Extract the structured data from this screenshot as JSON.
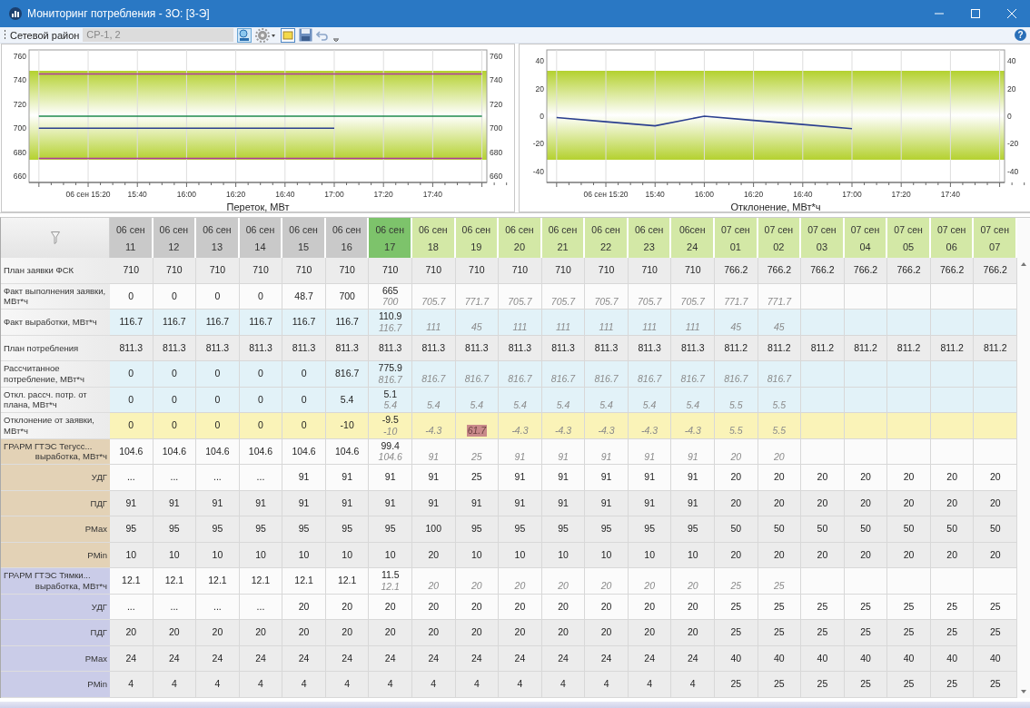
{
  "window": {
    "title": "Мониторинг потребления - 3О: [3-Э]"
  },
  "toolbar": {
    "label": "Сетевой район",
    "field_value": "СР-1, 2",
    "help": "?"
  },
  "charts": [
    {
      "left_axis_labels": [
        "760",
        "740",
        "720",
        "700",
        "680",
        "660"
      ],
      "chart_data": {
        "type": "line",
        "xlabel": "Переток, МВт",
        "categories": [
          null,
          "06 сен 15:20",
          "15:40",
          "16:00",
          "16:20",
          "16:40",
          "17:00",
          "17:20",
          "17:40",
          null
        ],
        "ylim": [
          655,
          765
        ],
        "yticks": [
          {
            "value": 660,
            "label": "660"
          },
          {
            "value": 680,
            "label": "680"
          },
          {
            "value": 700,
            "label": "700"
          },
          {
            "value": 720,
            "label": "720"
          },
          {
            "value": 740,
            "label": "740"
          },
          {
            "value": 760,
            "label": "760"
          }
        ],
        "grid": true,
        "series": [
          {
            "color": "#b03aa0",
            "values": [
              745,
              745,
              745,
              745,
              745,
              745,
              745,
              745,
              745,
              745
            ]
          },
          {
            "color": "#b03aa0",
            "values": [
              675,
              675,
              675,
              675,
              675,
              675,
              675,
              675,
              675,
              675
            ]
          },
          {
            "color": "#1f8a4c",
            "values": [
              710,
              710,
              710,
              710,
              710,
              710,
              710,
              710,
              710,
              710
            ]
          },
          {
            "color": "#2b3f8f",
            "values": [
              700,
              700,
              700,
              700,
              700,
              700,
              700,
              null,
              null,
              null
            ]
          }
        ]
      }
    },
    {
      "left_axis_labels": [
        "40",
        "20",
        "0",
        "-20",
        "-40"
      ],
      "chart_data": {
        "type": "line",
        "xlabel": "Отклонение, МВт*ч",
        "categories": [
          null,
          "06 сен 15:20",
          "15:40",
          "16:00",
          "16:20",
          "16:40",
          "17:00",
          "17:20",
          "17:40",
          null
        ],
        "ylim": [
          -48,
          48
        ],
        "yticks": [
          {
            "value": -40,
            "label": "-40"
          },
          {
            "value": -20,
            "label": "-20"
          },
          {
            "value": 0,
            "label": "0"
          },
          {
            "value": 20,
            "label": "20"
          },
          {
            "value": 40,
            "label": "40"
          }
        ],
        "grid": true,
        "series": [
          {
            "color": "#2b3f8f",
            "values": [
              -1,
              -4,
              -7,
              0,
              -3,
              -6,
              -9,
              null,
              null,
              null
            ]
          }
        ]
      }
    }
  ],
  "table": {
    "columns": [
      {
        "date": "06 сен",
        "hour": "11",
        "kind": "past"
      },
      {
        "date": "06 сен",
        "hour": "12",
        "kind": "past"
      },
      {
        "date": "06 сен",
        "hour": "13",
        "kind": "past"
      },
      {
        "date": "06 сен",
        "hour": "14",
        "kind": "past"
      },
      {
        "date": "06 сен",
        "hour": "15",
        "kind": "past"
      },
      {
        "date": "06 сен",
        "hour": "16",
        "kind": "past"
      },
      {
        "date": "06 сен",
        "hour": "17",
        "kind": "current"
      },
      {
        "date": "06 сен",
        "hour": "18",
        "kind": "future"
      },
      {
        "date": "06 сен",
        "hour": "19",
        "kind": "future"
      },
      {
        "date": "06 сен",
        "hour": "20",
        "kind": "future"
      },
      {
        "date": "06 сен",
        "hour": "21",
        "kind": "future"
      },
      {
        "date": "06 сен",
        "hour": "22",
        "kind": "future"
      },
      {
        "date": "06 сен",
        "hour": "23",
        "kind": "future"
      },
      {
        "date": "06сен",
        "hour": "24",
        "kind": "future"
      },
      {
        "date": "07 сен",
        "hour": "01",
        "kind": "future"
      },
      {
        "date": "07 сен",
        "hour": "02",
        "kind": "future"
      },
      {
        "date": "07 сен",
        "hour": "03",
        "kind": "future"
      },
      {
        "date": "07 сен",
        "hour": "04",
        "kind": "future"
      },
      {
        "date": "07 сен",
        "hour": "05",
        "kind": "future"
      },
      {
        "date": "07 сен",
        "hour": "06",
        "kind": "future"
      },
      {
        "date": "07 сен",
        "hour": "07",
        "kind": "future"
      }
    ],
    "rows": [
      {
        "label": "План заявки ФСК",
        "color": "#ececec",
        "cells": [
          {
            "value": "710"
          },
          {
            "value": "710"
          },
          {
            "value": "710"
          },
          {
            "value": "710"
          },
          {
            "value": "710"
          },
          {
            "value": "710"
          },
          {
            "value": "710"
          },
          {
            "value": "710"
          },
          {
            "value": "710"
          },
          {
            "value": "710"
          },
          {
            "value": "710"
          },
          {
            "value": "710"
          },
          {
            "value": "710"
          },
          {
            "value": "710"
          },
          {
            "value": "766.2"
          },
          {
            "value": "766.2"
          },
          {
            "value": "766.2"
          },
          {
            "value": "766.2"
          },
          {
            "value": "766.2"
          },
          {
            "value": "766.2"
          },
          {
            "value": "766.2"
          }
        ]
      },
      {
        "label": "Факт выполнения заявки, МВт*ч",
        "color": "#fbfbfb",
        "cells": [
          {
            "value": "0"
          },
          {
            "value": "0"
          },
          {
            "value": "0"
          },
          {
            "value": "0"
          },
          {
            "value": "48.7"
          },
          {
            "value": "700"
          },
          {
            "value": "665",
            "plan": "700"
          },
          {
            "plan": "705.7"
          },
          {
            "plan": "771.7"
          },
          {
            "plan": "705.7"
          },
          {
            "plan": "705.7"
          },
          {
            "plan": "705.7"
          },
          {
            "plan": "705.7"
          },
          {
            "plan": "705.7"
          },
          {
            "plan": "771.7"
          },
          {
            "plan": "771.7"
          },
          {},
          {},
          {},
          {},
          {}
        ]
      },
      {
        "label": "Факт выработки, МВт*ч",
        "color": "#e2f2f8",
        "cells": [
          {
            "value": "116.7"
          },
          {
            "value": "116.7"
          },
          {
            "value": "116.7"
          },
          {
            "value": "116.7"
          },
          {
            "value": "116.7"
          },
          {
            "value": "116.7"
          },
          {
            "value": "110.9",
            "plan": "116.7"
          },
          {
            "plan": "111"
          },
          {
            "plan": "45"
          },
          {
            "plan": "111"
          },
          {
            "plan": "111"
          },
          {
            "plan": "111"
          },
          {
            "plan": "111"
          },
          {
            "plan": "111"
          },
          {
            "plan": "45"
          },
          {
            "plan": "45"
          },
          {},
          {},
          {},
          {},
          {}
        ]
      },
      {
        "label": "План потребления",
        "color": "#ececec",
        "cells": [
          {
            "value": "811.3"
          },
          {
            "value": "811.3"
          },
          {
            "value": "811.3"
          },
          {
            "value": "811.3"
          },
          {
            "value": "811.3"
          },
          {
            "value": "811.3"
          },
          {
            "value": "811.3"
          },
          {
            "value": "811.3"
          },
          {
            "value": "811.3"
          },
          {
            "value": "811.3"
          },
          {
            "value": "811.3"
          },
          {
            "value": "811.3"
          },
          {
            "value": "811.3"
          },
          {
            "value": "811.3"
          },
          {
            "value": "811.2"
          },
          {
            "value": "811.2"
          },
          {
            "value": "811.2"
          },
          {
            "value": "811.2"
          },
          {
            "value": "811.2"
          },
          {
            "value": "811.2"
          },
          {
            "value": "811.2"
          }
        ]
      },
      {
        "label": "Рассчитанное потребление, МВт*ч",
        "color": "#e2f2f8",
        "cells": [
          {
            "value": "0"
          },
          {
            "value": "0"
          },
          {
            "value": "0"
          },
          {
            "value": "0"
          },
          {
            "value": "0"
          },
          {
            "value": "816.7"
          },
          {
            "value": "775.9",
            "plan": "816.7"
          },
          {
            "plan": "816.7"
          },
          {
            "plan": "816.7"
          },
          {
            "plan": "816.7"
          },
          {
            "plan": "816.7"
          },
          {
            "plan": "816.7"
          },
          {
            "plan": "816.7"
          },
          {
            "plan": "816.7"
          },
          {
            "plan": "816.7"
          },
          {
            "plan": "816.7"
          },
          {},
          {},
          {},
          {},
          {}
        ]
      },
      {
        "label": "Откл. рассч. потр. от плана, МВт*ч",
        "color": "#e2f2f8",
        "cells": [
          {
            "value": "0"
          },
          {
            "value": "0"
          },
          {
            "value": "0"
          },
          {
            "value": "0"
          },
          {
            "value": "0"
          },
          {
            "value": "5.4"
          },
          {
            "value": "5.1",
            "plan": "5.4"
          },
          {
            "plan": "5.4"
          },
          {
            "plan": "5.4"
          },
          {
            "plan": "5.4"
          },
          {
            "plan": "5.4"
          },
          {
            "plan": "5.4"
          },
          {
            "plan": "5.4"
          },
          {
            "plan": "5.4"
          },
          {
            "plan": "5.5"
          },
          {
            "plan": "5.5"
          },
          {},
          {},
          {},
          {},
          {}
        ]
      },
      {
        "label": "Отклонение от заявки, МВт*ч",
        "color": "#faf3b8",
        "cells": [
          {
            "value": "0"
          },
          {
            "value": "0"
          },
          {
            "value": "0"
          },
          {
            "value": "0"
          },
          {
            "value": "0"
          },
          {
            "value": "-10"
          },
          {
            "value": "-9.5",
            "plan": "-10",
            "alert": false
          },
          {
            "plan": "-4.3",
            "alert": false
          },
          {
            "plan": "61.7",
            "alert": true
          },
          {
            "plan": "-4.3",
            "alert": false
          },
          {
            "plan": "-4.3",
            "alert": false
          },
          {
            "plan": "-4.3",
            "alert": false
          },
          {
            "plan": "-4.3",
            "alert": false
          },
          {
            "plan": "-4.3",
            "alert": false
          },
          {
            "plan": "5.5",
            "alert": false
          },
          {
            "plan": "5.5",
            "alert": false
          },
          {},
          {},
          {},
          {},
          {}
        ]
      }
    ],
    "groups": [
      {
        "label": "ГРАРМ ГТЭС Тегусс...",
        "sublabel": "выработка, МВт*ч",
        "color": "#e3d2b6",
        "cells": [
          {
            "value": "104.6"
          },
          {
            "value": "104.6"
          },
          {
            "value": "104.6"
          },
          {
            "value": "104.6"
          },
          {
            "value": "104.6"
          },
          {
            "value": "104.6"
          },
          {
            "value": "99.4",
            "plan": "104.6"
          },
          {
            "plan": "91"
          },
          {
            "plan": "25"
          },
          {
            "plan": "91"
          },
          {
            "plan": "91"
          },
          {
            "plan": "91"
          },
          {
            "plan": "91"
          },
          {
            "plan": "91"
          },
          {
            "plan": "20"
          },
          {
            "plan": "20"
          },
          {},
          {},
          {},
          {},
          {}
        ],
        "rows": [
          {
            "label": "УДГ",
            "color": "#fbfbfb",
            "cells": [
              {
                "value": "..."
              },
              {
                "value": "..."
              },
              {
                "value": "..."
              },
              {
                "value": "..."
              },
              {
                "value": "91"
              },
              {
                "value": "91"
              },
              {
                "value": "91"
              },
              {
                "value": "91"
              },
              {
                "value": "25"
              },
              {
                "value": "91"
              },
              {
                "value": "91"
              },
              {
                "value": "91"
              },
              {
                "value": "91"
              },
              {
                "value": "91"
              },
              {
                "value": "20"
              },
              {
                "value": "20"
              },
              {
                "value": "20"
              },
              {
                "value": "20"
              },
              {
                "value": "20"
              },
              {
                "value": "20"
              },
              {
                "value": "20"
              }
            ]
          },
          {
            "label": "ПДГ",
            "color": "#ececec",
            "cells": [
              {
                "value": "91"
              },
              {
                "value": "91"
              },
              {
                "value": "91"
              },
              {
                "value": "91"
              },
              {
                "value": "91"
              },
              {
                "value": "91"
              },
              {
                "value": "91"
              },
              {
                "value": "91"
              },
              {
                "value": "91"
              },
              {
                "value": "91"
              },
              {
                "value": "91"
              },
              {
                "value": "91"
              },
              {
                "value": "91"
              },
              {
                "value": "91"
              },
              {
                "value": "20"
              },
              {
                "value": "20"
              },
              {
                "value": "20"
              },
              {
                "value": "20"
              },
              {
                "value": "20"
              },
              {
                "value": "20"
              },
              {
                "value": "20"
              }
            ]
          },
          {
            "label": "PMax",
            "color": "#ececec",
            "cells": [
              {
                "value": "95"
              },
              {
                "value": "95"
              },
              {
                "value": "95"
              },
              {
                "value": "95"
              },
              {
                "value": "95"
              },
              {
                "value": "95"
              },
              {
                "value": "95"
              },
              {
                "value": "100"
              },
              {
                "value": "95"
              },
              {
                "value": "95"
              },
              {
                "value": "95"
              },
              {
                "value": "95"
              },
              {
                "value": "95"
              },
              {
                "value": "95"
              },
              {
                "value": "50"
              },
              {
                "value": "50"
              },
              {
                "value": "50"
              },
              {
                "value": "50"
              },
              {
                "value": "50"
              },
              {
                "value": "50"
              },
              {
                "value": "50"
              }
            ]
          },
          {
            "label": "PMin",
            "color": "#ececec",
            "cells": [
              {
                "value": "10"
              },
              {
                "value": "10"
              },
              {
                "value": "10"
              },
              {
                "value": "10"
              },
              {
                "value": "10"
              },
              {
                "value": "10"
              },
              {
                "value": "10"
              },
              {
                "value": "20"
              },
              {
                "value": "10"
              },
              {
                "value": "10"
              },
              {
                "value": "10"
              },
              {
                "value": "10"
              },
              {
                "value": "10"
              },
              {
                "value": "10"
              },
              {
                "value": "20"
              },
              {
                "value": "20"
              },
              {
                "value": "20"
              },
              {
                "value": "20"
              },
              {
                "value": "20"
              },
              {
                "value": "20"
              },
              {
                "value": "20"
              }
            ]
          }
        ]
      },
      {
        "label": "ГРАРМ ГТЭС Тямки...",
        "sublabel": "выработка, МВт*ч",
        "color": "#cacce8",
        "cells": [
          {
            "value": "12.1"
          },
          {
            "value": "12.1"
          },
          {
            "value": "12.1"
          },
          {
            "value": "12.1"
          },
          {
            "value": "12.1"
          },
          {
            "value": "12.1"
          },
          {
            "value": "11.5",
            "plan": "12.1"
          },
          {
            "plan": "20"
          },
          {
            "plan": "20"
          },
          {
            "plan": "20"
          },
          {
            "plan": "20"
          },
          {
            "plan": "20"
          },
          {
            "plan": "20"
          },
          {
            "plan": "20"
          },
          {
            "plan": "25"
          },
          {
            "plan": "25"
          },
          {},
          {},
          {},
          {},
          {}
        ],
        "rows": [
          {
            "label": "УДГ",
            "color": "#fbfbfb",
            "cells": [
              {
                "value": "..."
              },
              {
                "value": "..."
              },
              {
                "value": "..."
              },
              {
                "value": "..."
              },
              {
                "value": "20"
              },
              {
                "value": "20"
              },
              {
                "value": "20"
              },
              {
                "value": "20"
              },
              {
                "value": "20"
              },
              {
                "value": "20"
              },
              {
                "value": "20"
              },
              {
                "value": "20"
              },
              {
                "value": "20"
              },
              {
                "value": "20"
              },
              {
                "value": "25"
              },
              {
                "value": "25"
              },
              {
                "value": "25"
              },
              {
                "value": "25"
              },
              {
                "value": "25"
              },
              {
                "value": "25"
              },
              {
                "value": "25"
              }
            ]
          },
          {
            "label": "ПДГ",
            "color": "#ececec",
            "cells": [
              {
                "value": "20"
              },
              {
                "value": "20"
              },
              {
                "value": "20"
              },
              {
                "value": "20"
              },
              {
                "value": "20"
              },
              {
                "value": "20"
              },
              {
                "value": "20"
              },
              {
                "value": "20"
              },
              {
                "value": "20"
              },
              {
                "value": "20"
              },
              {
                "value": "20"
              },
              {
                "value": "20"
              },
              {
                "value": "20"
              },
              {
                "value": "20"
              },
              {
                "value": "25"
              },
              {
                "value": "25"
              },
              {
                "value": "25"
              },
              {
                "value": "25"
              },
              {
                "value": "25"
              },
              {
                "value": "25"
              },
              {
                "value": "25"
              }
            ]
          },
          {
            "label": "PMax",
            "color": "#ececec",
            "cells": [
              {
                "value": "24"
              },
              {
                "value": "24"
              },
              {
                "value": "24"
              },
              {
                "value": "24"
              },
              {
                "value": "24"
              },
              {
                "value": "24"
              },
              {
                "value": "24"
              },
              {
                "value": "24"
              },
              {
                "value": "24"
              },
              {
                "value": "24"
              },
              {
                "value": "24"
              },
              {
                "value": "24"
              },
              {
                "value": "24"
              },
              {
                "value": "24"
              },
              {
                "value": "40"
              },
              {
                "value": "40"
              },
              {
                "value": "40"
              },
              {
                "value": "40"
              },
              {
                "value": "40"
              },
              {
                "value": "40"
              },
              {
                "value": "40"
              }
            ]
          },
          {
            "label": "PMin",
            "color": "#ececec",
            "cells": [
              {
                "value": "4"
              },
              {
                "value": "4"
              },
              {
                "value": "4"
              },
              {
                "value": "4"
              },
              {
                "value": "4"
              },
              {
                "value": "4"
              },
              {
                "value": "4"
              },
              {
                "value": "4"
              },
              {
                "value": "4"
              },
              {
                "value": "4"
              },
              {
                "value": "4"
              },
              {
                "value": "4"
              },
              {
                "value": "4"
              },
              {
                "value": "4"
              },
              {
                "value": "25"
              },
              {
                "value": "25"
              },
              {
                "value": "25"
              },
              {
                "value": "25"
              },
              {
                "value": "25"
              },
              {
                "value": "25"
              },
              {
                "value": "25"
              }
            ]
          }
        ]
      }
    ]
  }
}
